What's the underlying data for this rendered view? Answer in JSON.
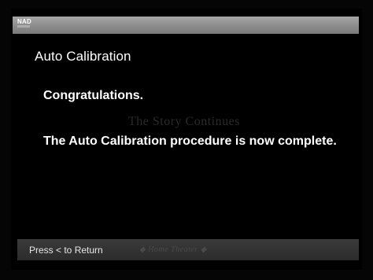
{
  "header": {
    "brand": "NAD"
  },
  "main": {
    "title": "Auto Calibration",
    "message_line1": "Congratulations.",
    "watermark": "The Story Continues",
    "message_line2": "The Auto Calibration procedure is now complete."
  },
  "footer": {
    "hint": "Press < to Return",
    "watermark": "◆ Home Theater ◆"
  },
  "colors": {
    "background": "#000000",
    "topbar": "#9a9a9a",
    "bottombar": "#333333",
    "text": "#ffffff"
  }
}
